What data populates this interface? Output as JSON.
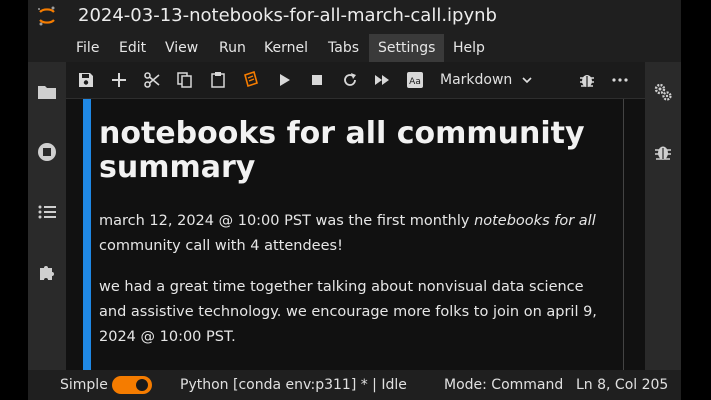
{
  "window": {
    "title": "2024-03-13-notebooks-for-all-march-call.ipynb"
  },
  "menu": [
    {
      "label": "File"
    },
    {
      "label": "Edit"
    },
    {
      "label": "View"
    },
    {
      "label": "Run"
    },
    {
      "label": "Kernel"
    },
    {
      "label": "Tabs"
    },
    {
      "label": "Settings",
      "active": true
    },
    {
      "label": "Help"
    }
  ],
  "toolbar": {
    "cell_type": "Markdown",
    "buttons": [
      "save-icon",
      "add-cell-icon",
      "cut-icon",
      "copy-icon",
      "paste-icon",
      "render-icon",
      "run-icon",
      "stop-icon",
      "restart-icon",
      "fast-forward-icon",
      "text-style-icon",
      "bug-icon",
      "more-icon"
    ]
  },
  "left_sidebar": [
    "folder-icon",
    "running-icon",
    "list-icon",
    "extension-icon"
  ],
  "right_sidebar": [
    "property-gears-icon",
    "debugger-icon"
  ],
  "notebook": {
    "heading": "notebooks for all community summary",
    "p1_a": "march 12, 2024 @ 10:00 PST was the first monthly ",
    "p1_em": "notebooks for all",
    "p1_b": " community call with 4 attendees!",
    "p2": "we had a great time together talking about nonvisual data science and assistive technology. we encourage more folks to join on april 9, 2024 @ 10:00 PST."
  },
  "status": {
    "mode_label": "Simple",
    "simple_mode_on": true,
    "kernel": "Python [conda env:p311] * | Idle",
    "mode": "Mode: Command",
    "cursor": "Ln 8, Col 205"
  },
  "colors": {
    "accent": "#1f88e5",
    "toggle": "#f57c00",
    "logo": "#f57c00"
  }
}
